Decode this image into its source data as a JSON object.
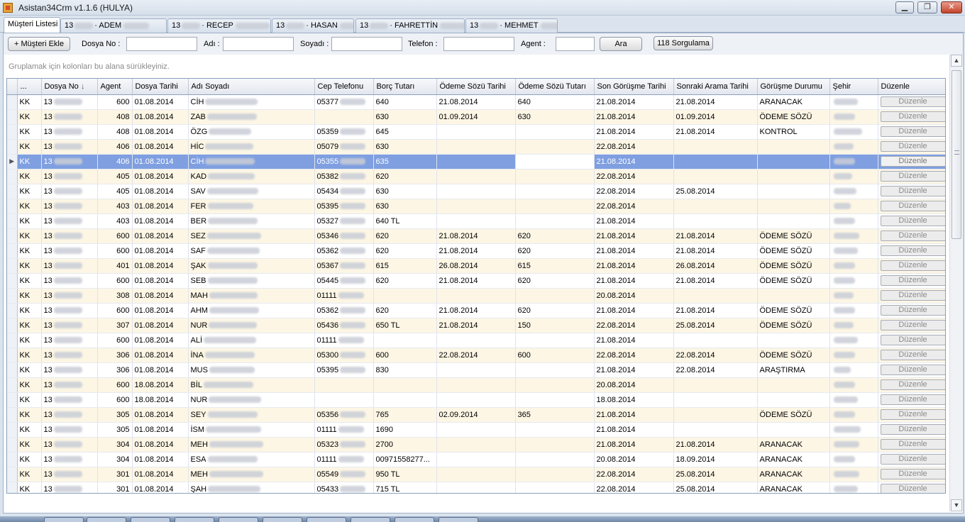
{
  "window": {
    "title": "Asistan34Crm v1.1.6 (HULYA)",
    "minimize": "▁",
    "maximize": "❐",
    "close": "✕"
  },
  "tabs": [
    {
      "label": "Müşteri Listesi"
    },
    {
      "label": "13",
      "name": "· ADEM"
    },
    {
      "label": "13",
      "name": "· RECEP"
    },
    {
      "label": "13",
      "name": "· HASAN"
    },
    {
      "label": "13",
      "name": "· FAHRETTİN"
    },
    {
      "label": "13",
      "name": "· MEHMET"
    }
  ],
  "toolbar": {
    "add_label": "+ Müşteri Ekle",
    "dosya_label": "Dosya No :",
    "adi_label": "Adı :",
    "soyadi_label": "Soyadı :",
    "telefon_label": "Telefon :",
    "agent_label": "Agent :",
    "search_label": "Ara",
    "query_label": "118 Sorgulama",
    "dosya_value": "",
    "adi_value": "",
    "soyadi_value": "",
    "telefon_value": "",
    "agent_value": ""
  },
  "group_hint": "Gruplamak için kolonları bu alana sürükleyiniz.",
  "icons": {
    "sort": "sort-desc-icon",
    "row": "row-indicator-icon",
    "up": "arrow-up-icon",
    "down": "arrow-down-icon"
  },
  "columns": [
    "...",
    "Dosya No",
    "Agent",
    "Dosya Tarihi",
    "Adı Soyadı",
    "Cep Telefonu",
    "Borç Tutarı",
    "Ödeme Sözü Tarihi",
    "Ödeme Sözü Tutarı",
    "Son Görüşme Tarihi",
    "Sonraki Arama Tarihi",
    "Görüşme Durumu",
    "Şehir",
    "Düzenle"
  ],
  "sort_arrow": "↓",
  "row_indicator": "▶",
  "edit_label": "Düzenle",
  "rows": [
    {
      "type": "KK",
      "dosya": "13",
      "agent": "600",
      "tarih": "01.08.2014",
      "ad": "CİH",
      "tel": "05377",
      "borc": "640",
      "sozTarih": "21.08.2014",
      "sozTutar": "640",
      "son": "21.08.2014",
      "sonraki": "21.08.2014",
      "durum": "ARANACAK"
    },
    {
      "type": "KK",
      "dosya": "13",
      "agent": "408",
      "tarih": "01.08.2014",
      "ad": "ZAB",
      "tel": "",
      "borc": "630",
      "sozTarih": "01.09.2014",
      "sozTutar": "630",
      "son": "21.08.2014",
      "sonraki": "01.09.2014",
      "durum": "ÖDEME SÖZÜ"
    },
    {
      "type": "KK",
      "dosya": "13",
      "agent": "408",
      "tarih": "01.08.2014",
      "ad": "ÖZG",
      "tel": "05359",
      "borc": "645",
      "sozTarih": "",
      "sozTutar": "",
      "son": "21.08.2014",
      "sonraki": "21.08.2014",
      "durum": "KONTROL"
    },
    {
      "type": "KK",
      "dosya": "13",
      "agent": "406",
      "tarih": "01.08.2014",
      "ad": "HİC",
      "tel": "05079",
      "borc": "630",
      "sozTarih": "",
      "sozTutar": "",
      "son": "22.08.2014",
      "sonraki": "",
      "durum": ""
    },
    {
      "type": "KK",
      "dosya": "13",
      "agent": "406",
      "tarih": "01.08.2014",
      "ad": "CİH",
      "tel": "05355",
      "borc": "635",
      "sozTarih": "",
      "sozTutar": "",
      "son": "21.08.2014",
      "sonraki": "",
      "durum": ""
    },
    {
      "type": "KK",
      "dosya": "13",
      "agent": "405",
      "tarih": "01.08.2014",
      "ad": "KAD",
      "tel": "05382",
      "borc": "620",
      "sozTarih": "",
      "sozTutar": "",
      "son": "22.08.2014",
      "sonraki": "",
      "durum": ""
    },
    {
      "type": "KK",
      "dosya": "13",
      "agent": "405",
      "tarih": "01.08.2014",
      "ad": "SAV",
      "tel": "05434",
      "borc": "630",
      "sozTarih": "",
      "sozTutar": "",
      "son": "22.08.2014",
      "sonraki": "25.08.2014",
      "durum": ""
    },
    {
      "type": "KK",
      "dosya": "13",
      "agent": "403",
      "tarih": "01.08.2014",
      "ad": "FER",
      "tel": "05395",
      "borc": "630",
      "sozTarih": "",
      "sozTutar": "",
      "son": "22.08.2014",
      "sonraki": "",
      "durum": ""
    },
    {
      "type": "KK",
      "dosya": "13",
      "agent": "403",
      "tarih": "01.08.2014",
      "ad": "BER",
      "tel": "05327",
      "borc": "640 TL",
      "sozTarih": "",
      "sozTutar": "",
      "son": "21.08.2014",
      "sonraki": "",
      "durum": ""
    },
    {
      "type": "KK",
      "dosya": "13",
      "agent": "600",
      "tarih": "01.08.2014",
      "ad": "SEZ",
      "tel": "05346",
      "borc": "620",
      "sozTarih": "21.08.2014",
      "sozTutar": "620",
      "son": "21.08.2014",
      "sonraki": "21.08.2014",
      "durum": "ÖDEME SÖZÜ"
    },
    {
      "type": "KK",
      "dosya": "13",
      "agent": "600",
      "tarih": "01.08.2014",
      "ad": "SAF",
      "tel": "05362",
      "borc": "620",
      "sozTarih": "21.08.2014",
      "sozTutar": "620",
      "son": "21.08.2014",
      "sonraki": "21.08.2014",
      "durum": "ÖDEME SÖZÜ"
    },
    {
      "type": "KK",
      "dosya": "13",
      "agent": "401",
      "tarih": "01.08.2014",
      "ad": "ŞAK",
      "tel": "05367",
      "borc": "615",
      "sozTarih": "26.08.2014",
      "sozTutar": "615",
      "son": "21.08.2014",
      "sonraki": "26.08.2014",
      "durum": "ÖDEME SÖZÜ"
    },
    {
      "type": "KK",
      "dosya": "13",
      "agent": "600",
      "tarih": "01.08.2014",
      "ad": "SEB",
      "tel": "05445",
      "borc": "620",
      "sozTarih": "21.08.2014",
      "sozTutar": "620",
      "son": "21.08.2014",
      "sonraki": "21.08.2014",
      "durum": "ÖDEME SÖZÜ"
    },
    {
      "type": "KK",
      "dosya": "13",
      "agent": "308",
      "tarih": "01.08.2014",
      "ad": "MAH",
      "tel": "01111",
      "borc": "",
      "sozTarih": "",
      "sozTutar": "",
      "son": "20.08.2014",
      "sonraki": "",
      "durum": ""
    },
    {
      "type": "KK",
      "dosya": "13",
      "agent": "600",
      "tarih": "01.08.2014",
      "ad": "AHM",
      "tel": "05362",
      "borc": "620",
      "sozTarih": "21.08.2014",
      "sozTutar": "620",
      "son": "21.08.2014",
      "sonraki": "21.08.2014",
      "durum": "ÖDEME SÖZÜ"
    },
    {
      "type": "KK",
      "dosya": "13",
      "agent": "307",
      "tarih": "01.08.2014",
      "ad": "NUR",
      "tel": "05436",
      "borc": "650 TL",
      "sozTarih": "21.08.2014",
      "sozTutar": "150",
      "son": "22.08.2014",
      "sonraki": "25.08.2014",
      "durum": "ÖDEME SÖZÜ"
    },
    {
      "type": "KK",
      "dosya": "13",
      "agent": "600",
      "tarih": "01.08.2014",
      "ad": "ALİ",
      "tel": "01111",
      "borc": "",
      "sozTarih": "",
      "sozTutar": "",
      "son": "21.08.2014",
      "sonraki": "",
      "durum": ""
    },
    {
      "type": "KK",
      "dosya": "13",
      "agent": "306",
      "tarih": "01.08.2014",
      "ad": "İNA",
      "tel": "05300",
      "borc": "600",
      "sozTarih": "22.08.2014",
      "sozTutar": "600",
      "son": "22.08.2014",
      "sonraki": "22.08.2014",
      "durum": "ÖDEME SÖZÜ"
    },
    {
      "type": "KK",
      "dosya": "13",
      "agent": "306",
      "tarih": "01.08.2014",
      "ad": "MUS",
      "tel": "05395",
      "borc": "830",
      "sozTarih": "",
      "sozTutar": "",
      "son": "21.08.2014",
      "sonraki": "22.08.2014",
      "durum": "ARAŞTIRMA"
    },
    {
      "type": "KK",
      "dosya": "13",
      "agent": "600",
      "tarih": "18.08.2014",
      "ad": "BİL",
      "tel": "",
      "borc": "",
      "sozTarih": "",
      "sozTutar": "",
      "son": "20.08.2014",
      "sonraki": "",
      "durum": ""
    },
    {
      "type": "KK",
      "dosya": "13",
      "agent": "600",
      "tarih": "18.08.2014",
      "ad": "NUR",
      "tel": "",
      "borc": "",
      "sozTarih": "",
      "sozTutar": "",
      "son": "18.08.2014",
      "sonraki": "",
      "durum": ""
    },
    {
      "type": "KK",
      "dosya": "13",
      "agent": "305",
      "tarih": "01.08.2014",
      "ad": "SEY",
      "tel": "05356",
      "borc": "765",
      "sozTarih": "02.09.2014",
      "sozTutar": "365",
      "son": "21.08.2014",
      "sonraki": "",
      "durum": "ÖDEME SÖZÜ"
    },
    {
      "type": "KK",
      "dosya": "13",
      "agent": "305",
      "tarih": "01.08.2014",
      "ad": "İSM",
      "tel": "01111",
      "borc": "1690",
      "sozTarih": "",
      "sozTutar": "",
      "son": "21.08.2014",
      "sonraki": "",
      "durum": ""
    },
    {
      "type": "KK",
      "dosya": "13",
      "agent": "304",
      "tarih": "01.08.2014",
      "ad": "MEH",
      "tel": "05323",
      "borc": "2700",
      "sozTarih": "",
      "sozTutar": "",
      "son": "21.08.2014",
      "sonraki": "21.08.2014",
      "durum": "ARANACAK"
    },
    {
      "type": "KK",
      "dosya": "13",
      "agent": "304",
      "tarih": "01.08.2014",
      "ad": "ESA",
      "tel": "01111",
      "borc": "00971558277...",
      "sozTarih": "",
      "sozTutar": "",
      "son": "20.08.2014",
      "sonraki": "18.09.2014",
      "durum": "ARANACAK"
    },
    {
      "type": "KK",
      "dosya": "13",
      "agent": "301",
      "tarih": "01.08.2014",
      "ad": "MEH",
      "tel": "05549",
      "borc": "950 TL",
      "sozTarih": "",
      "sozTutar": "",
      "son": "22.08.2014",
      "sonraki": "25.08.2014",
      "durum": "ARANACAK"
    },
    {
      "type": "KK",
      "dosya": "13",
      "agent": "301",
      "tarih": "01.08.2014",
      "ad": "ŞAH",
      "tel": "05433",
      "borc": "715 TL",
      "sozTarih": "",
      "sozTutar": "",
      "son": "22.08.2014",
      "sonraki": "25.08.2014",
      "durum": "ARANACAK"
    }
  ]
}
